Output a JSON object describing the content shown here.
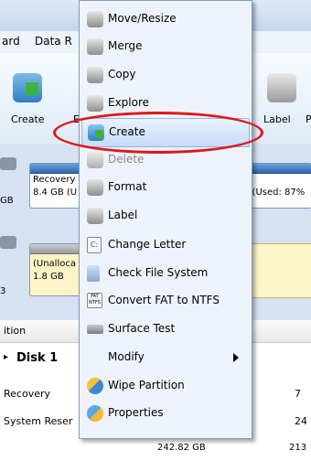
{
  "menubar": {
    "items": [
      "ard",
      "Data R"
    ]
  },
  "toolbar": {
    "create_label": "Create",
    "e_label": "E",
    "label_label": "Label",
    "p_label": "P"
  },
  "disk_map": {
    "partition1": {
      "name": "Recovery",
      "size": "8.4 GB (U",
      "left_size": "GB"
    },
    "partition2": {
      "name": ")",
      "size": "3 (Used: 87%"
    },
    "partition3": {
      "name": "(Unalloca",
      "size": "1.8 GB",
      "left_size": "3"
    }
  },
  "list": {
    "header": "ition",
    "disk": "Disk 1",
    "rows": [
      {
        "name": "Recovery",
        "value": "7"
      },
      {
        "name": "System Reser",
        "value": "24"
      },
      {
        "name": "",
        "size": "242.82 GB",
        "value": "213"
      }
    ]
  },
  "context_menu": {
    "items": [
      {
        "label": "Move/Resize",
        "icon": "disk-icon",
        "enabled": true
      },
      {
        "label": "Merge",
        "icon": "disk-icon",
        "enabled": true
      },
      {
        "label": "Copy",
        "icon": "disk-icon",
        "enabled": true
      },
      {
        "label": "Explore",
        "icon": "disk-icon",
        "enabled": true
      },
      {
        "label": "Create",
        "icon": "create-partition-icon",
        "enabled": true,
        "selected": true
      },
      {
        "label": "Delete",
        "icon": "disk-icon",
        "enabled": false
      },
      {
        "label": "Format",
        "icon": "disk-icon",
        "enabled": true
      },
      {
        "label": "Label",
        "icon": "disk-icon",
        "enabled": true
      },
      {
        "label": "Change Letter",
        "icon": "drive-letter-icon",
        "enabled": true
      },
      {
        "label": "Check File System",
        "icon": "check-icon",
        "enabled": true
      },
      {
        "label": "Convert FAT to NTFS",
        "icon": "convert-icon",
        "enabled": true
      },
      {
        "label": "Surface Test",
        "icon": "surface-test-icon",
        "enabled": true
      },
      {
        "label": "Modify",
        "icon": "",
        "enabled": true,
        "submenu": true
      },
      {
        "label": "Wipe Partition",
        "icon": "wipe-icon",
        "enabled": true
      },
      {
        "label": "Properties",
        "icon": "properties-icon",
        "enabled": true
      }
    ]
  },
  "colors": {
    "highlight_ellipse": "#e0151b",
    "menu_bg": "#eef3fb"
  }
}
